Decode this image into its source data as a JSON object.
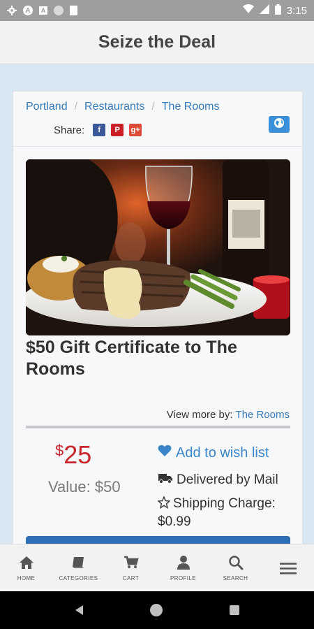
{
  "status_bar": {
    "time": "3:15",
    "icons": [
      "settings-icon",
      "a-icon",
      "a-square-icon",
      "dot-icon",
      "sd-card-icon",
      "wifi-icon",
      "signal-icon",
      "battery-icon"
    ]
  },
  "header": {
    "title": "Seize the Deal"
  },
  "breadcrumb": [
    "Portland",
    "Restaurants",
    "The Rooms"
  ],
  "share": {
    "label": "Share:",
    "facebook": "f",
    "pinterest": "P",
    "google": "g+"
  },
  "deal": {
    "title": "$50 Gift Certificate to The Rooms",
    "view_more_label": "View more by:",
    "view_more_link": "The Rooms",
    "price_currency": "$",
    "price_amount": "25",
    "value": "Value: $50",
    "wish_list": "Add to wish list",
    "delivery": "Delivered by Mail",
    "shipping": "Shipping Charge: $0.99"
  },
  "bottom_nav": [
    {
      "label": "HOME",
      "icon": "home-icon"
    },
    {
      "label": "CATEGORIES",
      "icon": "book-icon"
    },
    {
      "label": "CART",
      "icon": "cart-icon"
    },
    {
      "label": "PROFILE",
      "icon": "user-icon"
    },
    {
      "label": "SEARCH",
      "icon": "search-icon"
    },
    {
      "label": "",
      "icon": "menu-icon"
    }
  ],
  "colors": {
    "link": "#337ab7",
    "price": "#c8282d",
    "accent": "#3a86c8"
  }
}
